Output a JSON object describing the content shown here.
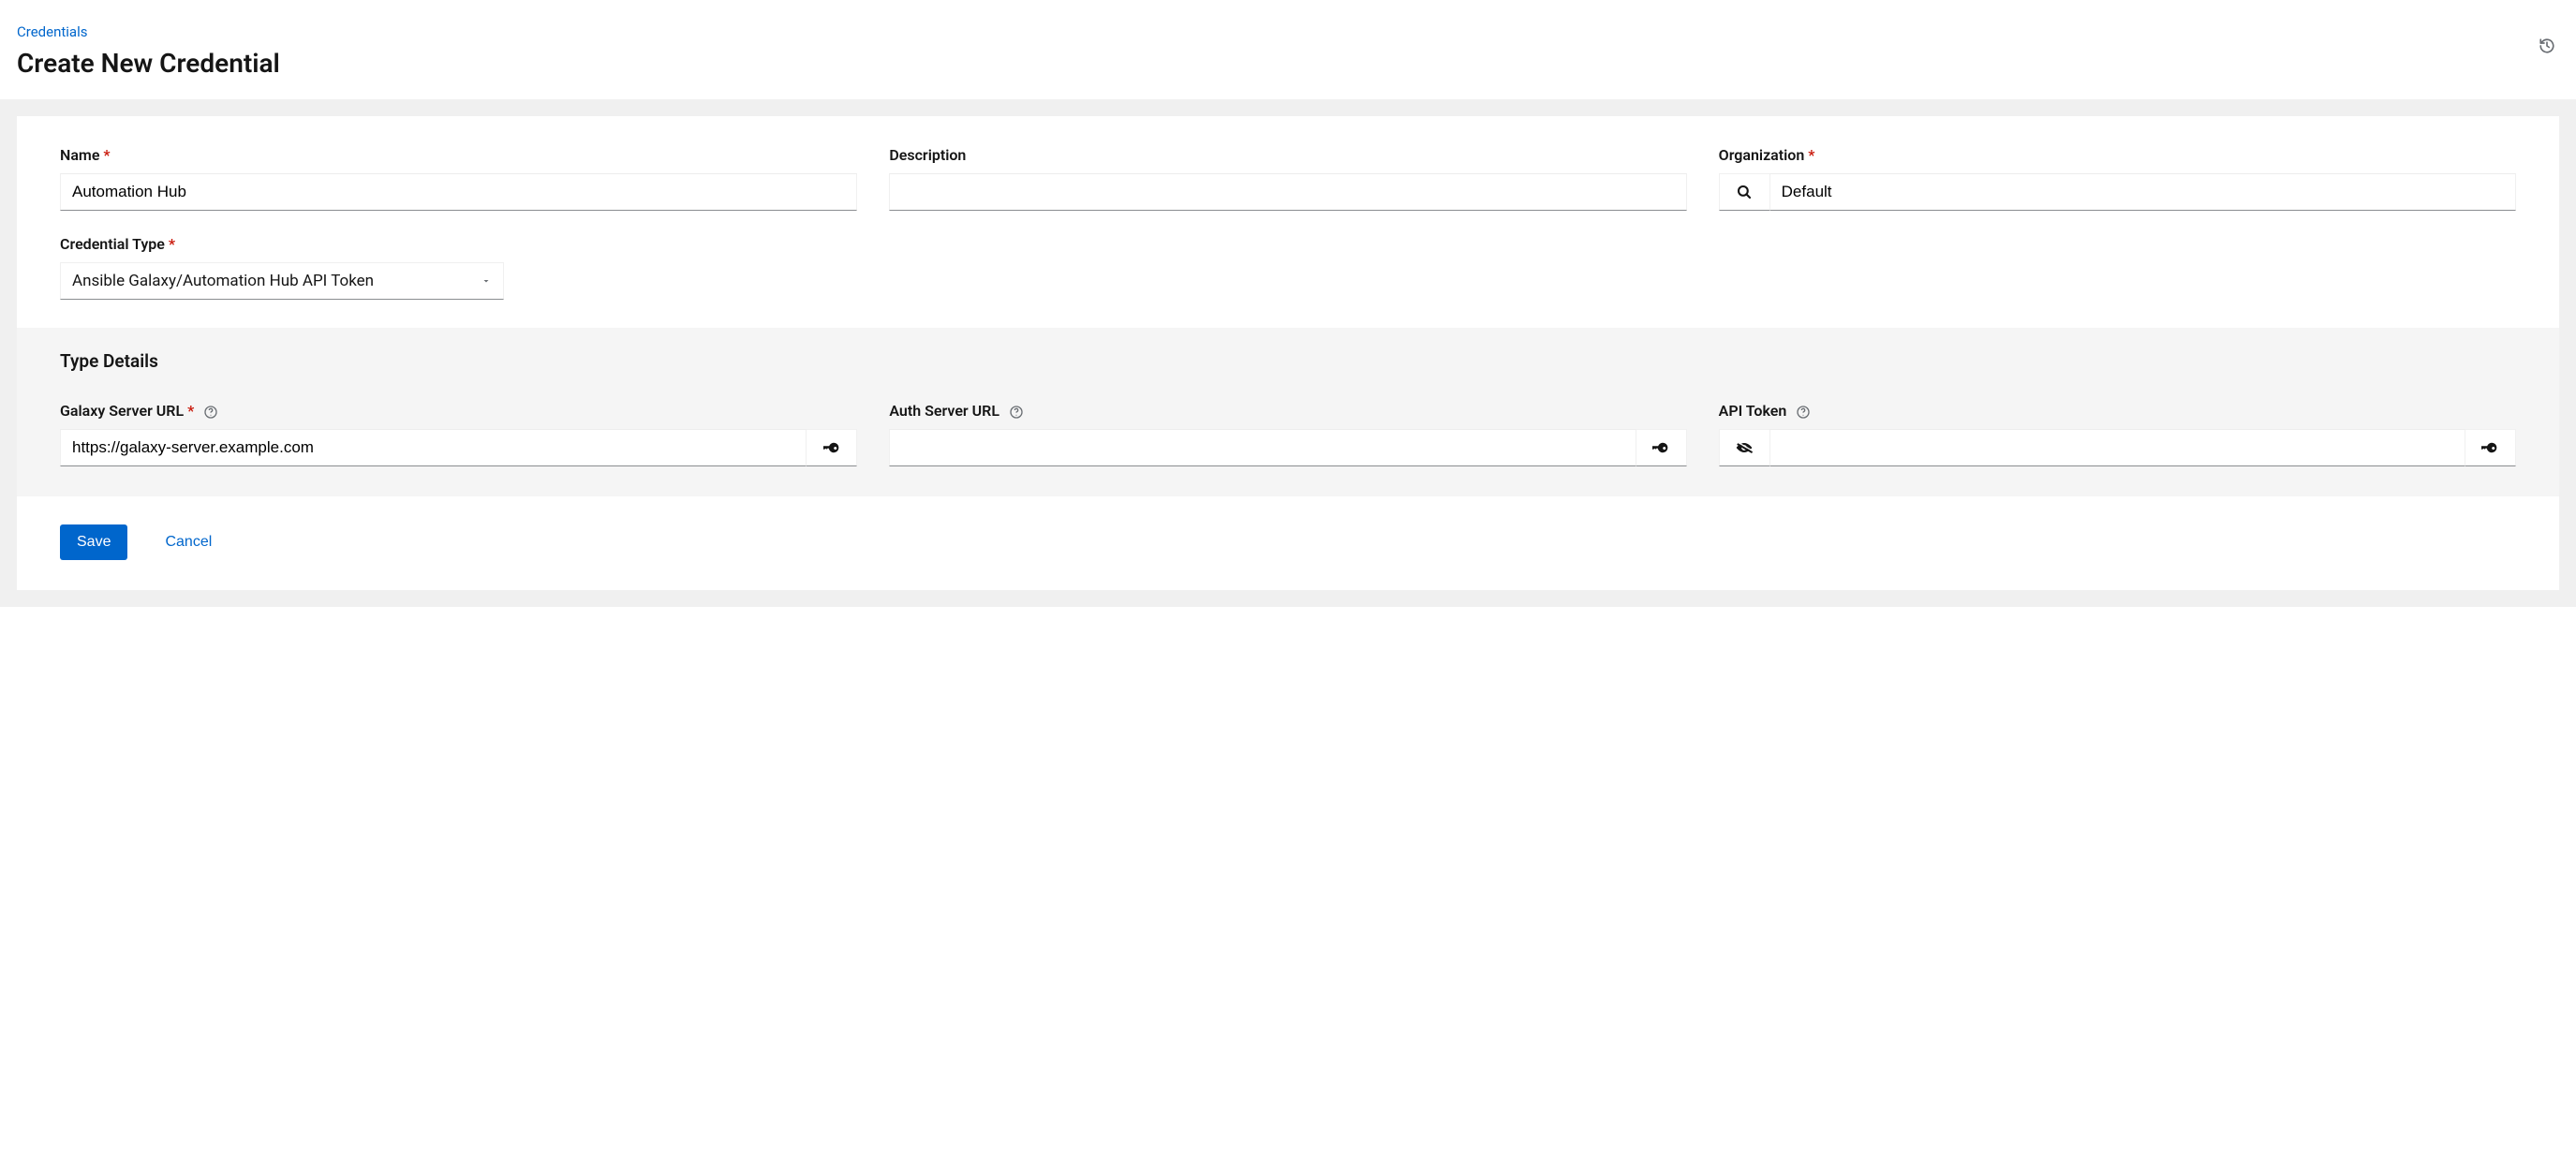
{
  "breadcrumb": "Credentials",
  "title": "Create New Credential",
  "form": {
    "name": {
      "label": "Name",
      "value": "Automation Hub"
    },
    "description": {
      "label": "Description",
      "value": ""
    },
    "organization": {
      "label": "Organization",
      "value": "Default"
    },
    "credential_type": {
      "label": "Credential Type",
      "value": "Ansible Galaxy/Automation Hub API Token"
    }
  },
  "type_details": {
    "title": "Type Details",
    "galaxy_server_url": {
      "label": "Galaxy Server URL",
      "value": "https://galaxy-server.example.com"
    },
    "auth_server_url": {
      "label": "Auth Server URL",
      "value": ""
    },
    "api_token": {
      "label": "API Token",
      "value": ""
    }
  },
  "footer": {
    "save": "Save",
    "cancel": "Cancel"
  }
}
